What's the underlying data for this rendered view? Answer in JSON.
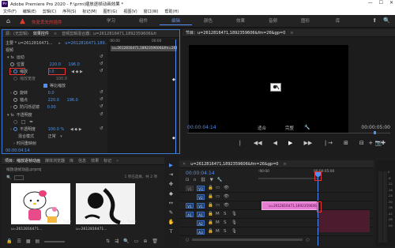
{
  "window": {
    "title": "Adobe Premiere Pro 2020 - F:\\prm\\缩放逐帧动画效果 *",
    "app_icon": "Pr",
    "controls": [
      "—",
      "☐",
      "✕"
    ]
  },
  "menu": [
    "文件(F)",
    "编辑(E)",
    "剪辑(C)",
    "序列(S)",
    "标记(M)",
    "图形(G)",
    "视图(V)",
    "窗口(W)",
    "帮助(H)"
  ],
  "workspace": {
    "alert_text": "恢复丢失的插件",
    "tabs": [
      "学习",
      "组件",
      "编辑",
      "颜色",
      "效果",
      "音频",
      "图形",
      "库"
    ],
    "active_tab": "编辑",
    "right_icons": [
      "⬆",
      "🔍"
    ]
  },
  "effects_panel": {
    "tabs": [
      "源：(无剪辑)",
      "效果控件",
      "≡",
      "音频剪辑混合器：u=2612816471,1892359606&fm=26&gp=0"
    ],
    "active_tab_index": 1,
    "master_label": "主要 * u=2612816471...",
    "clip_label": "u=2612816471,189...",
    "mini_ruler_left": ":00:00",
    "mini_ruler_right": "00:00",
    "mini_clip_label": "u=2612816471,1892359606&fm=26&gp=0",
    "section_video": "视频",
    "motion": "运动",
    "position_label": "位置",
    "position_x": "220.0",
    "position_y": "196.0",
    "scale_label": "缩放",
    "scale_value": "0.0",
    "scale_width_label": "缩放宽度",
    "uniform_scale": "等比缩放",
    "rotation_label": "旋转",
    "rotation_value": "0.0",
    "anchor_label": "锚点",
    "anchor_x": "220.0",
    "anchor_y": "196.0",
    "flicker_label": "防闪烁滤镜",
    "flicker_value": "0.00",
    "opacity_section": "不透明度",
    "opacity_label": "不透明度",
    "opacity_value": "100.0 %",
    "blend_label": "混合模式",
    "blend_value": "正常",
    "time_remap": "时间重映射",
    "footer_tc": "00:00:04:14"
  },
  "program_monitor": {
    "title": "节目：u=2612816471,1892359606&fm=26&gp=0",
    "timecode": "00:00:04:14",
    "fit": "适合",
    "quality": "完整",
    "duration": "00:00:05:00",
    "controls": [
      "❘",
      "◀◀",
      "◀",
      "▶",
      "▶▶",
      "❘→",
      "⊞",
      "⊟",
      "📷"
    ],
    "tail": [
      "+",
      "✚"
    ]
  },
  "project_panel": {
    "tabs": [
      "项目：缩放逐帧动画",
      "媒体浏览器",
      "库",
      "信息",
      "效果",
      "标记"
    ],
    "path": "缩放逐帧动画.prproj",
    "pager": "1 项已选择，共 2 项",
    "items": [
      {
        "name": "u=2612816471...",
        "duration": "5:00"
      },
      {
        "name": "u=2612816471...",
        "duration": "5:00"
      }
    ]
  },
  "tools": [
    "▶",
    "⇥",
    "✥",
    "◆",
    "↔",
    "✎",
    "✋",
    "T"
  ],
  "timeline": {
    "title": "u=2612816471,1892359606&fm=26&gp=0",
    "timecode": "00:00:04:14",
    "ruler_left": ":00:00",
    "ruler_right": "00:00:05:00",
    "tracks": [
      {
        "id": "V3",
        "type": "video"
      },
      {
        "id": "V2",
        "type": "video"
      },
      {
        "id": "V1",
        "type": "video"
      },
      {
        "id": "A1",
        "type": "audio"
      },
      {
        "id": "A2",
        "type": "audio"
      },
      {
        "id": "A3",
        "type": "audio"
      }
    ],
    "clip_label": "u=2612816471,1892359606&fm=26&gp=0.jpg",
    "meter_scale": [
      "0",
      "-6",
      "-12",
      "-18",
      "-24",
      "-30",
      "-36",
      "-42",
      "-48",
      "-54"
    ]
  },
  "colors": {
    "accent_blue": "#4f8ff7",
    "alert_red": "#e03a2f",
    "clip_pink": "#e87bd4",
    "audio_maroon": "#4a1c2e"
  }
}
